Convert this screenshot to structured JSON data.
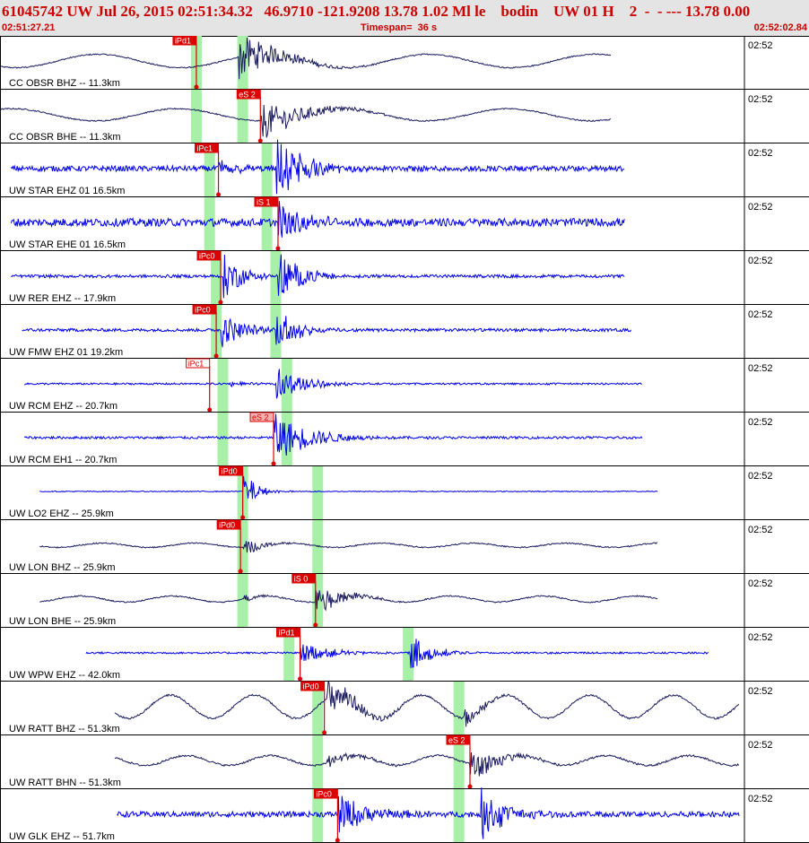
{
  "header": {
    "title": "61045742 UW Jul 26, 2015 02:51:34.32   46.9710 -121.9208 13.78 1.02 Ml le    bodin    UW 01 H    2  -  - --- 13.78 0.00",
    "start_time": "02:51:27.21",
    "timespan": "Timespan=  36 s",
    "end_time": "02:52:02.84"
  },
  "colors": {
    "header_bg": "#e4e4e4",
    "header_text": "#cc0000",
    "wave_vertical": "#0000ee",
    "wave_dark": "#1a1a5e",
    "pick_red": "#dd0000",
    "pick_pink": "#f4b0b0",
    "highlight_green": "#a8f0a8"
  },
  "chart_data": {
    "type": "seismogram",
    "time_range_s": [
      0,
      36
    ],
    "traces": [
      {
        "label": "CC OBSR BHZ -- 11.3km",
        "time": "02:52",
        "start": 0,
        "end": 27.7,
        "color": "dark",
        "amp": 0.22,
        "noise": 0.02,
        "wave_period": 7.5,
        "bursts": [
          {
            "t": 10.8,
            "a": 0.8,
            "d": 3.5
          }
        ],
        "picks": [
          {
            "label": "iPd1",
            "t": 8.9,
            "style": "red"
          }
        ],
        "green": [
          8.9,
          11.0
        ]
      },
      {
        "label": "CC OBSR BHE -- 11.3km",
        "time": "02:52",
        "start": 0,
        "end": 27.7,
        "color": "dark",
        "amp": 0.2,
        "noise": 0.02,
        "wave_period": 7.5,
        "bursts": [
          {
            "t": 11.8,
            "a": 0.65,
            "d": 4
          }
        ],
        "picks": [
          {
            "label": "eS 2",
            "t": 11.8,
            "style": "red"
          }
        ],
        "green": [
          8.9,
          11.0
        ]
      },
      {
        "label": "UW STAR EHZ 01 16.5km",
        "time": "02:52",
        "start": 0.5,
        "end": 28.3,
        "color": "blue",
        "amp": 0.0,
        "noise": 0.09,
        "wave_period": 0,
        "bursts": [
          {
            "t": 9.9,
            "a": 0.45,
            "d": 1.5
          },
          {
            "t": 12.5,
            "a": 1.1,
            "d": 2.8
          }
        ],
        "picks": [
          {
            "label": "iPc1",
            "t": 9.9,
            "style": "red"
          }
        ],
        "green": [
          9.5,
          12.1
        ]
      },
      {
        "label": "UW STAR EHE 01 16.5km",
        "time": "02:52",
        "start": 0.5,
        "end": 28.3,
        "color": "blue",
        "amp": 0.0,
        "noise": 0.13,
        "wave_period": 0,
        "bursts": [
          {
            "t": 12.6,
            "a": 0.75,
            "d": 2.5
          }
        ],
        "picks": [
          {
            "label": "iS 1",
            "t": 12.6,
            "style": "red"
          }
        ],
        "green": [
          9.5,
          12.1
        ]
      },
      {
        "label": "UW RER EHZ -- 17.9km",
        "time": "02:52",
        "start": 0.5,
        "end": 28.3,
        "color": "blue",
        "amp": 0.0,
        "noise": 0.05,
        "wave_period": 0,
        "bursts": [
          {
            "t": 10.1,
            "a": 0.8,
            "d": 1.8
          },
          {
            "t": 12.6,
            "a": 0.85,
            "d": 2.2
          }
        ],
        "picks": [
          {
            "label": "iPc0",
            "t": 10.0,
            "style": "red"
          }
        ],
        "green": [
          9.8,
          12.5
        ]
      },
      {
        "label": "UW FMW EHZ 01 19.2km",
        "time": "02:52",
        "start": 1.0,
        "end": 28.6,
        "color": "blue",
        "amp": 0.0,
        "noise": 0.05,
        "wave_period": 0,
        "bursts": [
          {
            "t": 10.0,
            "a": 0.6,
            "d": 2.2
          },
          {
            "t": 12.5,
            "a": 0.75,
            "d": 2.2
          }
        ],
        "picks": [
          {
            "label": "iPc0",
            "t": 9.8,
            "style": "red"
          }
        ],
        "green": [
          9.8,
          12.5
        ]
      },
      {
        "label": "UW RCM EHZ -- 20.7km",
        "time": "02:52",
        "start": 1.1,
        "end": 29.1,
        "color": "blue",
        "amp": 0.0,
        "noise": 0.03,
        "wave_period": 0,
        "bursts": [
          {
            "t": 10.4,
            "a": 0.1,
            "d": 1.5
          },
          {
            "t": 12.5,
            "a": 0.6,
            "d": 2.5
          }
        ],
        "picks": [
          {
            "label": "iPc1",
            "t": 9.5,
            "style": "white"
          }
        ],
        "green": [
          10.1,
          13.0
        ]
      },
      {
        "label": "UW RCM EH1 -- 20.7km",
        "time": "02:52",
        "start": 1.1,
        "end": 29.1,
        "color": "blue",
        "amp": 0.0,
        "noise": 0.04,
        "wave_period": 0,
        "bursts": [
          {
            "t": 12.4,
            "a": 0.85,
            "d": 3.5
          }
        ],
        "picks": [
          {
            "label": "eS 2",
            "t": 12.4,
            "style": "pink"
          }
        ],
        "green": [
          10.1,
          13.0
        ]
      },
      {
        "label": "UW LO2 EHZ -- 25.9km",
        "time": "02:52",
        "start": 1.8,
        "end": 29.8,
        "color": "blue",
        "amp": 0.0,
        "noise": 0.015,
        "wave_period": 0,
        "bursts": [
          {
            "t": 11.0,
            "a": 0.75,
            "d": 1.2
          }
        ],
        "picks": [
          {
            "label": "iPd0",
            "t": 11.0,
            "style": "red"
          }
        ],
        "green": [
          11.0,
          14.4
        ]
      },
      {
        "label": "UW LON BHZ -- 25.9km",
        "time": "02:52",
        "start": 1.8,
        "end": 29.8,
        "color": "dark",
        "amp": 0.07,
        "noise": 0.02,
        "wave_period": 4.2,
        "bursts": [
          {
            "t": 11.0,
            "a": 0.35,
            "d": 1.5
          }
        ],
        "picks": [
          {
            "label": "iPd0",
            "t": 10.9,
            "style": "red"
          }
        ],
        "green": [
          11.0,
          14.4
        ]
      },
      {
        "label": "UW LON BHE -- 25.9km",
        "time": "02:52",
        "start": 1.8,
        "end": 29.8,
        "color": "dark",
        "amp": 0.1,
        "noise": 0.02,
        "wave_period": 4.2,
        "bursts": [
          {
            "t": 11.0,
            "a": 0.15,
            "d": 1.5
          },
          {
            "t": 14.3,
            "a": 0.5,
            "d": 2.5
          }
        ],
        "picks": [
          {
            "label": "iS 0",
            "t": 14.3,
            "style": "red"
          }
        ],
        "green": [
          11.0,
          14.4
        ]
      },
      {
        "label": "UW WPW EHZ -- 42.0km",
        "time": "02:52",
        "start": 3.9,
        "end": 32.1,
        "color": "blue",
        "amp": 0.0,
        "noise": 0.03,
        "wave_period": 0,
        "bursts": [
          {
            "t": 13.6,
            "a": 0.35,
            "d": 3
          },
          {
            "t": 18.6,
            "a": 0.6,
            "d": 2
          }
        ],
        "picks": [
          {
            "label": "iPd1",
            "t": 13.6,
            "style": "red"
          }
        ],
        "green": [
          13.1,
          18.5
        ]
      },
      {
        "label": "UW RATT BHZ -- 51.3km",
        "time": "02:52",
        "start": 5.2,
        "end": 33.5,
        "color": "dark",
        "amp": 0.38,
        "noise": 0.03,
        "wave_period": 3.8,
        "bursts": [
          {
            "t": 14.8,
            "a": 0.7,
            "d": 2.5
          },
          {
            "t": 21.0,
            "a": 0.35,
            "d": 2
          }
        ],
        "picks": [
          {
            "label": "iPd0",
            "t": 14.7,
            "style": "red"
          }
        ],
        "green": [
          14.4,
          20.8
        ]
      },
      {
        "label": "UW RATT BHN -- 51.3km",
        "time": "02:52",
        "start": 5.2,
        "end": 33.5,
        "color": "dark",
        "amp": 0.16,
        "noise": 0.03,
        "wave_period": 3.8,
        "bursts": [
          {
            "t": 14.8,
            "a": 0.25,
            "d": 2.5
          },
          {
            "t": 21.3,
            "a": 0.6,
            "d": 2.5
          }
        ],
        "picks": [
          {
            "label": "eS 2",
            "t": 21.3,
            "style": "red"
          }
        ],
        "green": [
          14.4,
          20.8
        ]
      },
      {
        "label": "UW GLK EHZ -- 51.7km",
        "time": "02:52",
        "start": 5.3,
        "end": 33.5,
        "color": "blue",
        "amp": 0.0,
        "noise": 0.09,
        "wave_period": 0,
        "bursts": [
          {
            "t": 15.3,
            "a": 0.7,
            "d": 3
          },
          {
            "t": 21.8,
            "a": 0.9,
            "d": 2.2
          }
        ],
        "picks": [
          {
            "label": "iPc0",
            "t": 15.3,
            "style": "red"
          }
        ],
        "green": [
          14.4,
          20.8
        ]
      }
    ]
  }
}
